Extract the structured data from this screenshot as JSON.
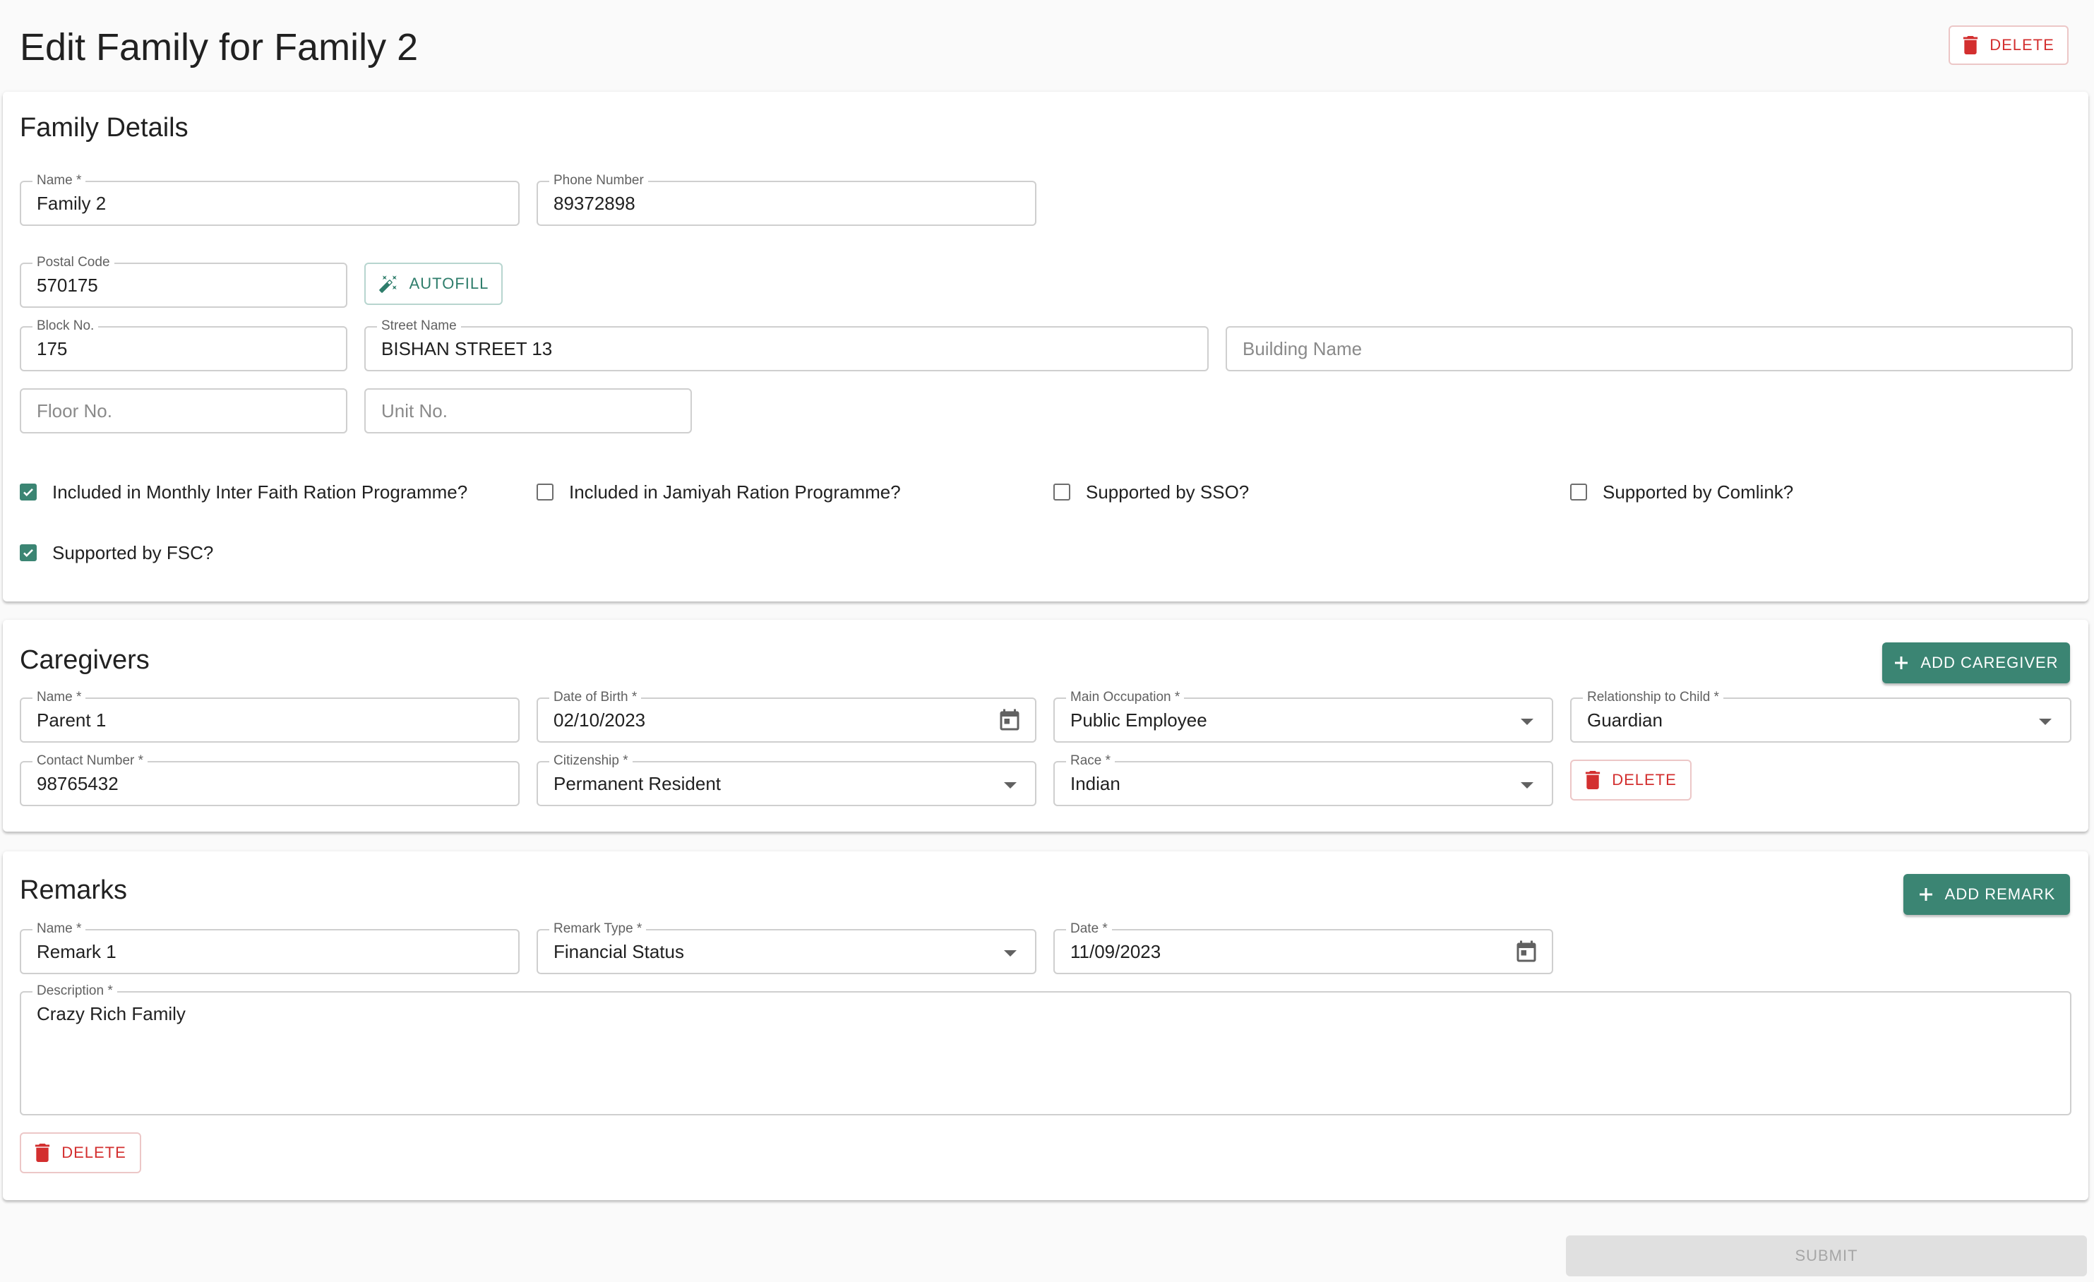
{
  "page": {
    "title": "Edit Family for Family 2",
    "delete_label": "DELETE"
  },
  "family_details": {
    "title": "Family Details",
    "name": {
      "label": "Name *",
      "value": "Family 2"
    },
    "phone": {
      "label": "Phone Number",
      "value": "89372898"
    },
    "postal": {
      "label": "Postal Code",
      "value": "570175"
    },
    "autofill_label": "AUTOFILL",
    "block": {
      "label": "Block No.",
      "value": "175"
    },
    "street": {
      "label": "Street Name",
      "value": "BISHAN STREET 13"
    },
    "building": {
      "placeholder": "Building Name"
    },
    "floor": {
      "placeholder": "Floor No."
    },
    "unit": {
      "placeholder": "Unit No."
    },
    "checkboxes": [
      {
        "label": "Included in Monthly Inter Faith Ration Programme?",
        "checked": true
      },
      {
        "label": "Included in Jamiyah Ration Programme?",
        "checked": false
      },
      {
        "label": "Supported by SSO?",
        "checked": false
      },
      {
        "label": "Supported by Comlink?",
        "checked": false
      },
      {
        "label": "Supported by FSC?",
        "checked": true
      }
    ]
  },
  "caregivers": {
    "title": "Caregivers",
    "add_label": "ADD CAREGIVER",
    "items": [
      {
        "name": {
          "label": "Name *",
          "value": "Parent 1"
        },
        "dob": {
          "label": "Date of Birth *",
          "value": "02/10/2023"
        },
        "occupation": {
          "label": "Main Occupation *",
          "value": "Public Employee"
        },
        "relationship": {
          "label": "Relationship to Child *",
          "value": "Guardian"
        },
        "contact": {
          "label": "Contact Number *",
          "value": "98765432"
        },
        "citizenship": {
          "label": "Citizenship *",
          "value": "Permanent Resident"
        },
        "race": {
          "label": "Race *",
          "value": "Indian"
        },
        "delete_label": "DELETE"
      }
    ]
  },
  "remarks": {
    "title": "Remarks",
    "add_label": "ADD REMARK",
    "items": [
      {
        "name": {
          "label": "Name *",
          "value": "Remark 1"
        },
        "type": {
          "label": "Remark Type *",
          "value": "Financial Status"
        },
        "date": {
          "label": "Date *",
          "value": "11/09/2023"
        },
        "description": {
          "label": "Description *",
          "value": "Crazy Rich Family"
        },
        "delete_label": "DELETE"
      }
    ]
  },
  "submit_label": "SUBMIT",
  "colors": {
    "accent": "#3b8573",
    "danger": "#d32f2f",
    "disabled": "#e0e0e0"
  }
}
